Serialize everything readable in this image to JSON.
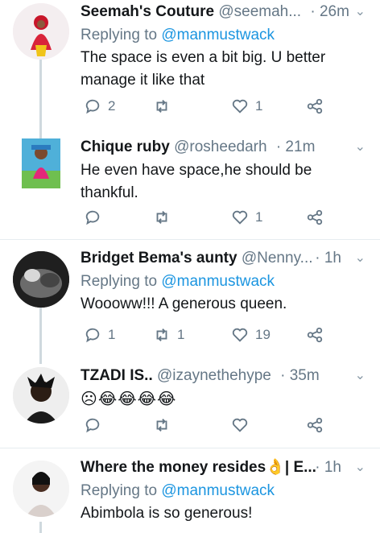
{
  "tweets": [
    {
      "name": "Seemah's Couture",
      "handle": "@seemah...",
      "time": "· 26m",
      "replying_prefix": "Replying to ",
      "replying_to": "@manmustwack",
      "text": "The space is even a bit big. U better manage it like that",
      "reply_count": "2",
      "retweet_count": "",
      "like_count": "1"
    },
    {
      "name": "Chique ruby",
      "handle": "@rosheedarh",
      "time": "· 21m",
      "text": "He even have space,he should be thankful.",
      "reply_count": "",
      "retweet_count": "",
      "like_count": "1"
    },
    {
      "name": "Bridget Bema's aunty",
      "handle": "@Nenny...",
      "time": "· 1h",
      "replying_prefix": "Replying to ",
      "replying_to": "@manmustwack",
      "text": "Woooww!!! A generous queen.",
      "reply_count": "1",
      "retweet_count": "1",
      "like_count": "19"
    },
    {
      "name": "TZADI IS..",
      "handle": "@izaynethehype",
      "time": "· 35m",
      "text": "☹😂😂😂😂",
      "reply_count": "",
      "retweet_count": "",
      "like_count": ""
    },
    {
      "name": "Where the money resides👌| E...",
      "handle": "",
      "time": "· 1h",
      "replying_prefix": "Replying to ",
      "replying_to": "@manmustwack",
      "text": "Abimbola is so generous!"
    }
  ],
  "colors": {
    "link": "#1b95e0",
    "muted": "#657786",
    "divider": "#e6ecf0",
    "text": "#14171a"
  },
  "icons": [
    "reply-icon",
    "retweet-icon",
    "like-icon",
    "share-icon",
    "chevron-down-icon"
  ]
}
